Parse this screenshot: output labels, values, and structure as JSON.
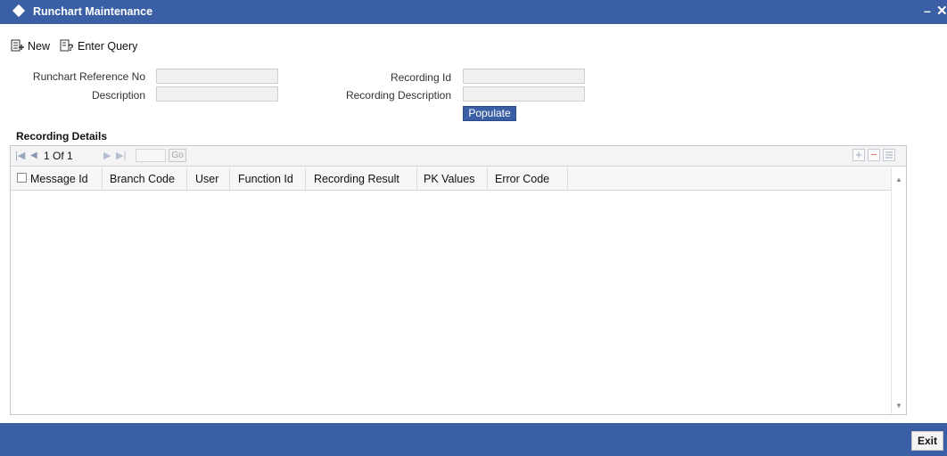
{
  "window": {
    "title": "Runchart Maintenance",
    "minimize": "–",
    "close": "✕"
  },
  "toolbar": {
    "new_label": "New",
    "enter_query_label": "Enter Query"
  },
  "form": {
    "ref_no_label": "Runchart Reference No",
    "ref_no_value": "",
    "description_label": "Description",
    "description_value": "",
    "recording_id_label": "Recording Id",
    "recording_id_value": "",
    "recording_desc_label": "Recording Description",
    "recording_desc_value": "",
    "populate_label": "Populate"
  },
  "details": {
    "title": "Recording Details",
    "pager_text": "1 Of 1",
    "go_label": "Go",
    "add_icon": "plus-icon",
    "delete_icon": "minus-icon",
    "view_icon": "list-view-icon",
    "columns": [
      "Message Id",
      "Branch Code",
      "User",
      "Function Id",
      "Recording Result",
      "PK Values",
      "Error Code"
    ],
    "rows": []
  },
  "footer": {
    "exit_label": "Exit"
  },
  "colors": {
    "accent": "#3a5fa4"
  }
}
